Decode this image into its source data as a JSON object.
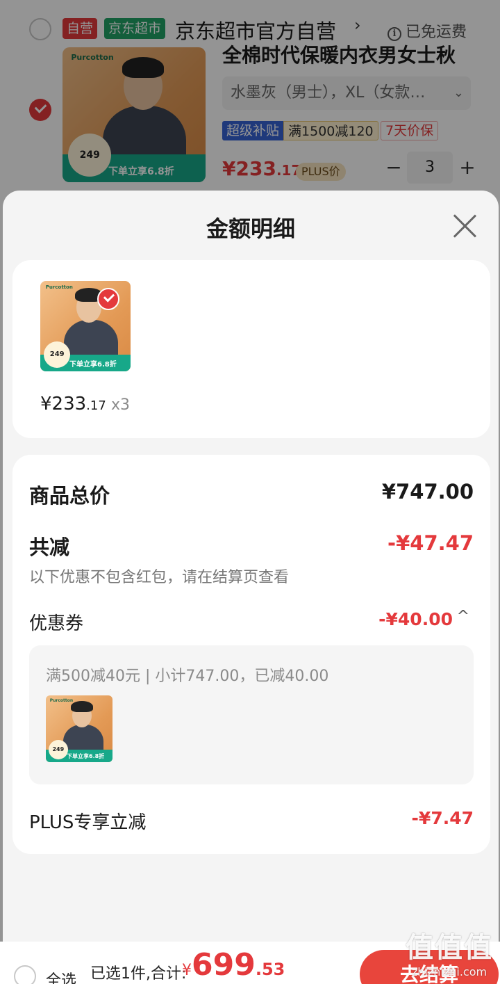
{
  "cart": {
    "shop": {
      "tag_self": "自营",
      "tag_jd": "京东超市",
      "name": "京东超市官方自营",
      "chevron": "›",
      "free_shipping": "已免运费",
      "info_icon": "i"
    },
    "item": {
      "title": "全棉时代保暖内衣男女士秋",
      "variant": "水墨灰（男士），XL（女款…",
      "variant_chevron": "⌄",
      "subsidy_a": "超级补贴",
      "subsidy_b": "满1500减120",
      "guarantee": "7天价保",
      "price_int": "¥233",
      "price_dec": ".17",
      "plus_tag": "PLUS价",
      "qty": "3",
      "minus": "−",
      "plus": "+"
    },
    "image": {
      "logo": "Purcotton",
      "badge_price": "249",
      "band_text": "下单立享6.8折"
    }
  },
  "sheet": {
    "title": "金额明细",
    "item_price_int": "¥233",
    "item_price_dec": ".17",
    "item_count": "x3",
    "total_label": "商品总价",
    "total_value": "¥747.00",
    "discount_label": "共减",
    "discount_value": "-¥47.47",
    "discount_note": "以下优惠不包含红包，请在结算页查看",
    "coupon_label": "优惠券",
    "coupon_value": "-¥40.00",
    "coupon_chevron": "^",
    "coupon_desc": "满500减40元 | 小计747.00，已减40.00",
    "plus_label": "PLUS专享立减",
    "plus_value": "-¥7.47"
  },
  "bottom": {
    "select_all": "全选",
    "summary": "已选1件,合计:",
    "currency": "¥",
    "total_int": "699",
    "total_dec": ".53",
    "checkout": "去结算"
  },
  "watermark": {
    "big": "值值值",
    "small": "zhizhizhi.com"
  },
  "colors": {
    "accent": "#e4393c",
    "jd_green": "#21a366",
    "subsidy_blue": "#3662d4"
  }
}
